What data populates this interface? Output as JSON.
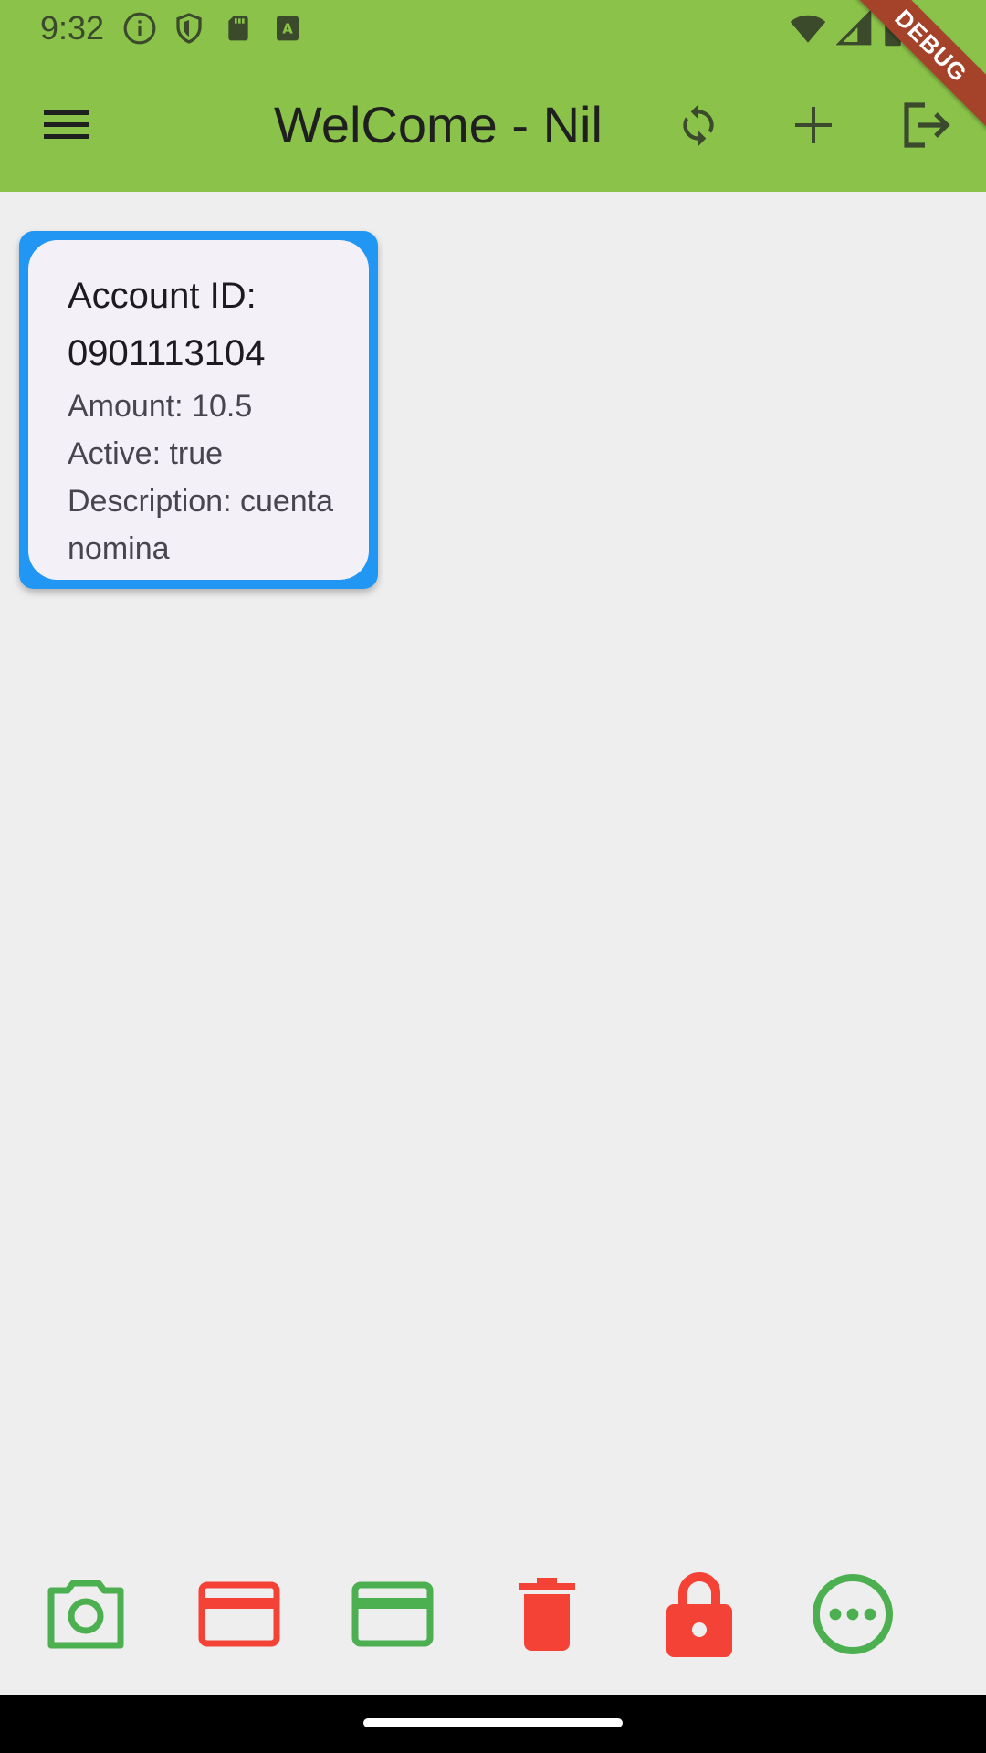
{
  "status_bar": {
    "time": "9:32",
    "icons": [
      "info-icon",
      "shield-icon",
      "sd-card-icon",
      "a-notification-icon",
      "wifi-icon",
      "signal-icon",
      "battery-icon"
    ]
  },
  "app_bar": {
    "title": "WelCome - Nil",
    "background": "#8bc34a",
    "actions": [
      "menu-icon",
      "refresh-icon",
      "add-icon",
      "logout-icon"
    ]
  },
  "debug_banner": {
    "label": "DEBUG",
    "color": "#a5432a"
  },
  "account_card": {
    "border_color": "#2196f3",
    "account_id": "Account ID: 0901113104",
    "amount": "Amount: 10.5",
    "active": "Active: true",
    "description": "Description: cuenta nomina"
  },
  "bottom_actions": [
    {
      "icon": "camera-icon",
      "color": "#4caf50"
    },
    {
      "icon": "credit-card-icon",
      "color": "#f44336"
    },
    {
      "icon": "credit-card-icon",
      "color": "#4caf50"
    },
    {
      "icon": "delete-icon",
      "color": "#f44336"
    },
    {
      "icon": "lock-icon",
      "color": "#f44336"
    },
    {
      "icon": "more-icon",
      "color": "#4caf50"
    }
  ]
}
